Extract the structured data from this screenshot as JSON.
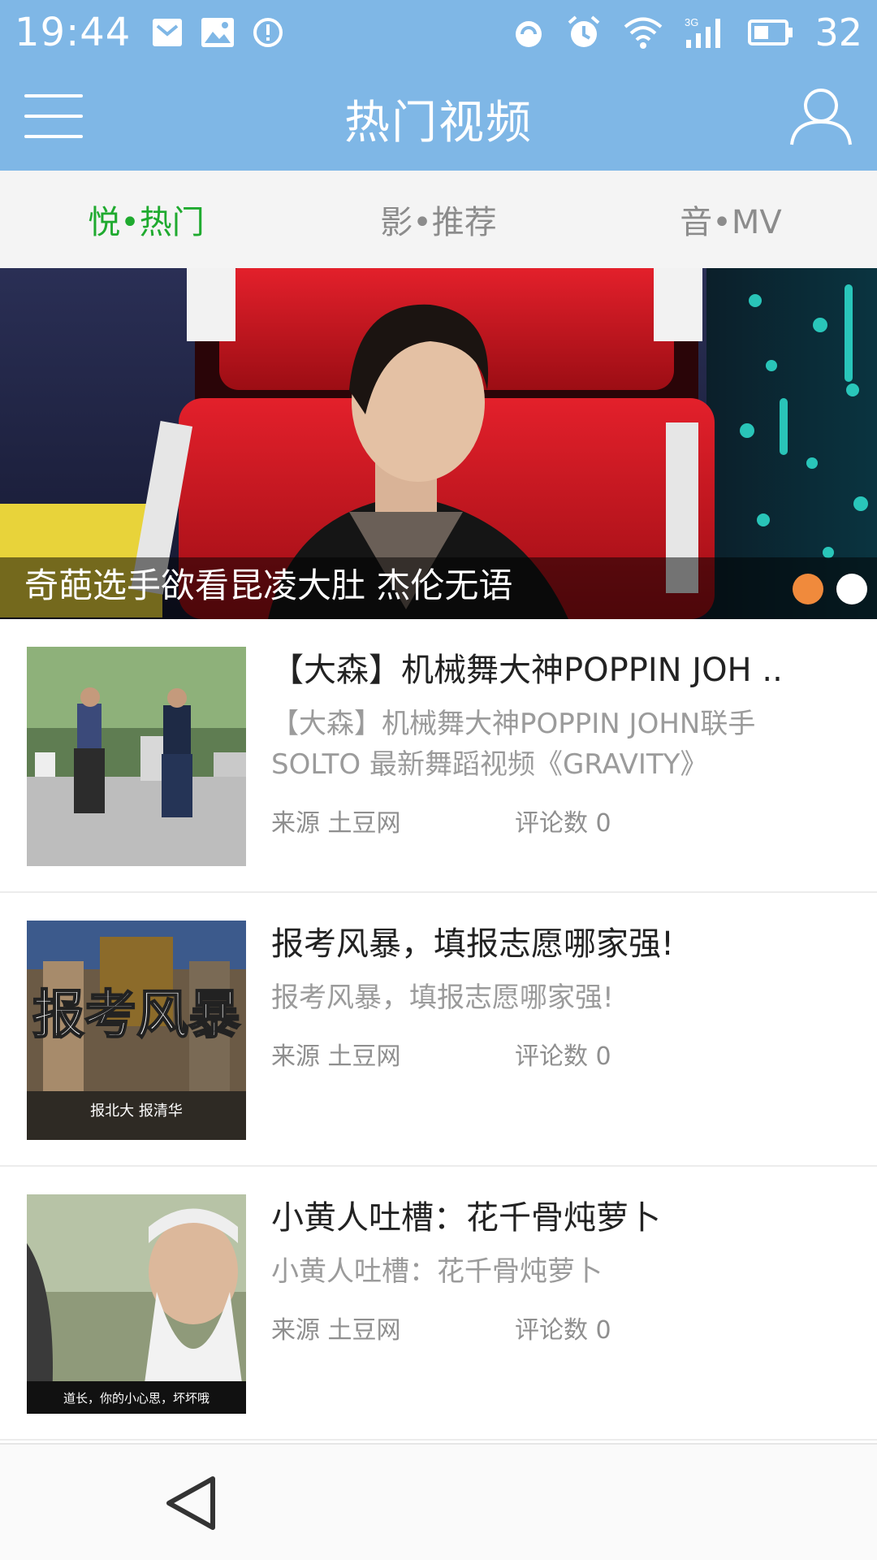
{
  "status_bar": {
    "time": "19:44",
    "battery_level": "32",
    "icons": [
      "mail-icon",
      "image-icon",
      "alert-icon",
      "sync-icon",
      "alarm-icon",
      "wifi-icon",
      "signal-3g-icon",
      "battery-icon"
    ]
  },
  "header": {
    "title": "热门视频",
    "menu_icon": "hamburger-menu-icon",
    "user_icon": "user-profile-icon",
    "background": "#7fb7e6"
  },
  "tabs": [
    {
      "label": "悦•热门",
      "active": true
    },
    {
      "label": "影•推荐",
      "active": false
    },
    {
      "label": "音•MV",
      "active": false
    }
  ],
  "accent_color": "#1faa2f",
  "banner": {
    "caption": "奇葩选手欲看昆凌大肚 杰伦无语",
    "dots": [
      {
        "active": true,
        "color": "#f08a3c"
      },
      {
        "active": false,
        "color": "#ffffff"
      }
    ]
  },
  "videos": [
    {
      "title": "【大森】机械舞大神POPPIN JOH ..",
      "description": "【大森】机械舞大神POPPIN JOHN联手SOLTO 最新舞蹈视频《GRAVITY》",
      "source": "来源 土豆网",
      "comments": "评论数 0",
      "thumb_text": ""
    },
    {
      "title": "报考风暴，填报志愿哪家强!",
      "description": "报考风暴，填报志愿哪家强!",
      "source": "来源 土豆网",
      "comments": "评论数 0",
      "thumb_text": "报考风暴",
      "thumb_subtext": "报北大 报清华"
    },
    {
      "title": "小黄人吐槽：花千骨炖萝卜",
      "description": "小黄人吐槽：花千骨炖萝卜",
      "source": "来源 土豆网",
      "comments": "评论数 0",
      "thumb_subtext": "道长，你的小心思，坏坏哦"
    }
  ],
  "nav_bar": {
    "back_icon": "back-triangle-icon"
  }
}
